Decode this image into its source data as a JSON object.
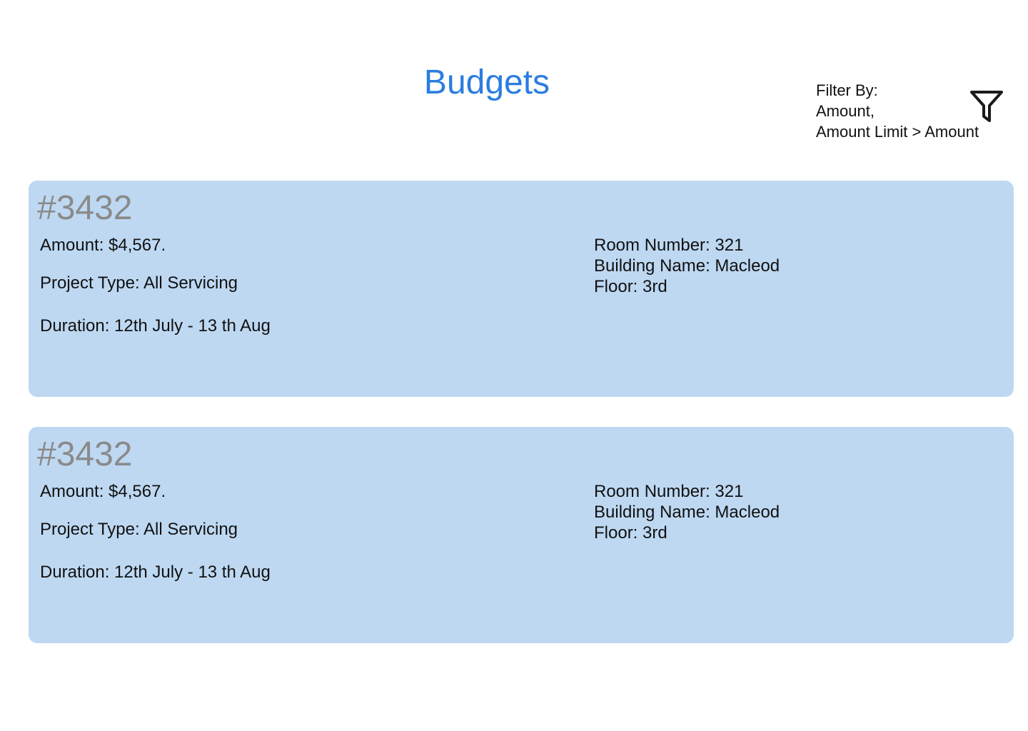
{
  "page": {
    "title": "Budgets"
  },
  "filter": {
    "line1": "Filter By:",
    "line2": "Amount,",
    "line3": "Amount Limit > Amount",
    "icon": "filter-funnel-icon"
  },
  "budgets": [
    {
      "id": "#3432",
      "amount": "Amount: $4,567.",
      "project_type": "Project Type: All Servicing",
      "duration": "Duration: 12th July - 13 th Aug",
      "room_number": "Room Number: 321",
      "building_name": "Building Name: Macleod",
      "floor": "Floor: 3rd"
    },
    {
      "id": "#3432",
      "amount": "Amount: $4,567.",
      "project_type": "Project Type: All Servicing",
      "duration": "Duration: 12th July - 13 th Aug",
      "room_number": "Room Number: 321",
      "building_name": "Building Name: Macleod",
      "floor": "Floor: 3rd"
    }
  ],
  "colors": {
    "title": "#2a7de1",
    "card_background": "#bed8f2",
    "card_id": "#8a8a8a",
    "text": "#111111"
  }
}
